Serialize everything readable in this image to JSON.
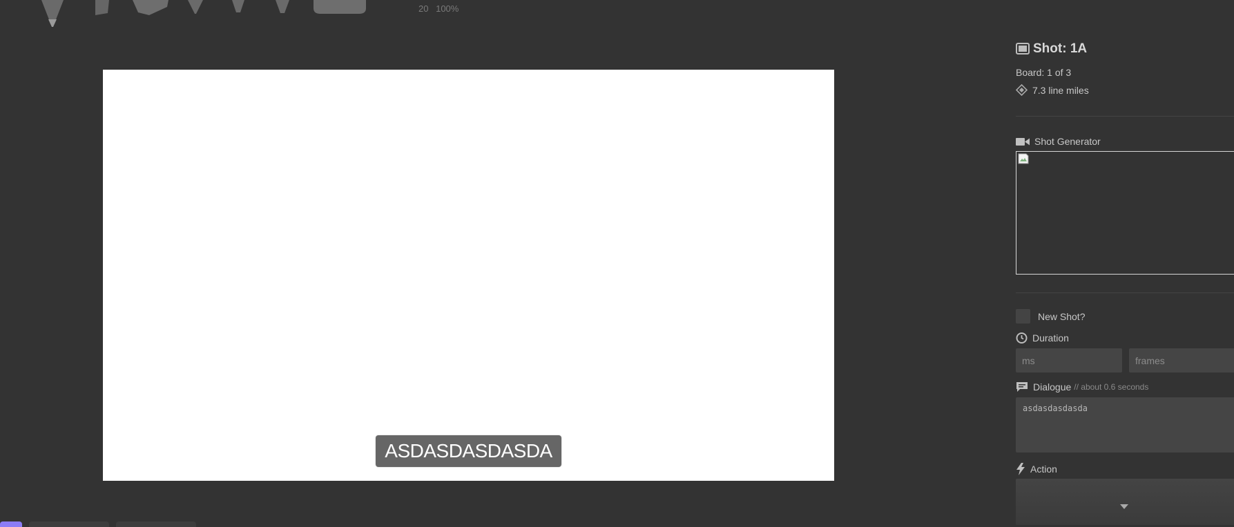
{
  "toolbar": {
    "tools": [
      "pencil-tool",
      "marker-tool",
      "chisel-tool",
      "pen-tool",
      "brush-tool",
      "fine-brush-tool",
      "eraser-tool"
    ],
    "brush_size": "20",
    "brush_opacity": "100%"
  },
  "canvas": {
    "caption": "ASDASDASDASDA"
  },
  "shot": {
    "title": "Shot: 1A",
    "board": "Board: 1 of 3",
    "line_miles": "7.3 line miles"
  },
  "shot_generator": {
    "label": "Shot Generator"
  },
  "new_shot": {
    "label": "New Shot?"
  },
  "duration": {
    "label": "Duration",
    "ms_placeholder": "ms",
    "frames_placeholder": "frames"
  },
  "dialogue": {
    "label": "Dialogue",
    "hint": "// about 0.6 seconds",
    "value": "asdasdasdasda"
  },
  "action": {
    "label": "Action"
  },
  "colors": {
    "background": "#333333",
    "canvas": "#ffffff",
    "field": "#454545",
    "accent": "#8b7cf6"
  }
}
